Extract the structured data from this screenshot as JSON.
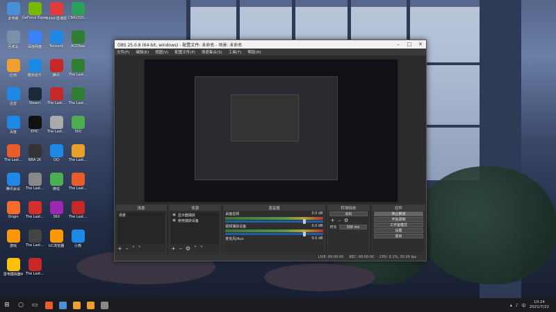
{
  "desktop": {
    "icons": [
      {
        "label": "此电脑",
        "color": "#4a90d9"
      },
      {
        "label": "GeForce Experience",
        "color": "#76b900"
      },
      {
        "label": "Bilibili直播姬",
        "color": "#e23b3b"
      },
      {
        "label": "CBA2020...",
        "color": "#2e9e5b"
      },
      {
        "label": "回收站",
        "color": "#7a8fa8"
      },
      {
        "label": "百度网盘",
        "color": "#3b82f6"
      },
      {
        "label": "Tencent",
        "color": "#1e88e5"
      },
      {
        "label": "ACDSee",
        "color": "#2e7d32"
      },
      {
        "label": "应用",
        "color": "#f0a030"
      },
      {
        "label": "酷狗音乐",
        "color": "#1e88e5"
      },
      {
        "label": "腾讯",
        "color": "#c62828"
      },
      {
        "label": "The Last...",
        "color": "#2e7d32"
      },
      {
        "label": "迅雷",
        "color": "#1e88e5"
      },
      {
        "label": "Steam",
        "color": "#1b2838"
      },
      {
        "label": "The Last...",
        "color": "#c62828"
      },
      {
        "label": "The Last...",
        "color": "#2e7d32"
      },
      {
        "label": "百度",
        "color": "#1e88e5"
      },
      {
        "label": "EPIC",
        "color": "#111111"
      },
      {
        "label": "The Last...",
        "color": "#aaaaaa"
      },
      {
        "label": "360",
        "color": "#4caf50"
      },
      {
        "label": "The Last...",
        "color": "#e85d2a"
      },
      {
        "label": "NBA 2K",
        "color": "#333333"
      },
      {
        "label": "QQ",
        "color": "#1e88e5"
      },
      {
        "label": "The Last...",
        "color": "#e8a02a"
      },
      {
        "label": "腾讯会议",
        "color": "#1e88e5"
      },
      {
        "label": "The Last...",
        "color": "#888888"
      },
      {
        "label": "微信",
        "color": "#4caf50"
      },
      {
        "label": "The Last...",
        "color": "#e85d2a"
      },
      {
        "label": "Origin",
        "color": "#f56c2d"
      },
      {
        "label": "The Last...",
        "color": "#d32f2f"
      },
      {
        "label": "360",
        "color": "#9c27b0"
      },
      {
        "label": "The Last...",
        "color": "#c62828"
      },
      {
        "label": "游戏",
        "color": "#ff9800"
      },
      {
        "label": "The Last...",
        "color": "#444444"
      },
      {
        "label": "UC浏览器",
        "color": "#ff9800"
      },
      {
        "label": "小熊",
        "color": "#1e88e5"
      },
      {
        "label": "雷电模拟器4",
        "color": "#ffc107"
      },
      {
        "label": "The Last...",
        "color": "#c62828"
      }
    ]
  },
  "obs": {
    "title": "OBS 25.0.8 (64-bit, windows) - 配置文件: 未命名 - 场景: 未命名",
    "menu": [
      "文件(F)",
      "编辑(E)",
      "视图(V)",
      "配置文件(P)",
      "场景集合(S)",
      "工具(T)",
      "帮助(H)"
    ],
    "docks": {
      "scenes": {
        "title": "场景",
        "items": [
          "场景"
        ]
      },
      "sources": {
        "title": "来源",
        "items": [
          "显示器捕获",
          "使用捕获设备"
        ]
      },
      "mixer": {
        "title": "混音器",
        "channels": [
          {
            "name": "桌面音频",
            "db": "0.0 dB"
          },
          {
            "name": "视频捕获设备",
            "db": "0.0 dB"
          },
          {
            "name": "麦克风/Aux",
            "db": "0.0 dB"
          }
        ]
      },
      "transitions": {
        "title": "转场特效",
        "type": "淡出",
        "duration_label": "时长",
        "duration": "300 ms"
      },
      "controls": {
        "title": "控件",
        "buttons": [
          "停止推流",
          "开始录制",
          "工作室模式",
          "设置",
          "退出"
        ]
      }
    },
    "status": {
      "live": "LIVE: 00:00:00",
      "rec": "REC: 00:00:00",
      "cpu": "CPU: 0.1%, 30.00 fps"
    }
  },
  "taskbar": {
    "time": "10:24",
    "date": "2021/7/22",
    "apps": [
      "#e85d2a",
      "#4a90d9",
      "#f0a030",
      "#e8a02a",
      "#888888"
    ]
  }
}
